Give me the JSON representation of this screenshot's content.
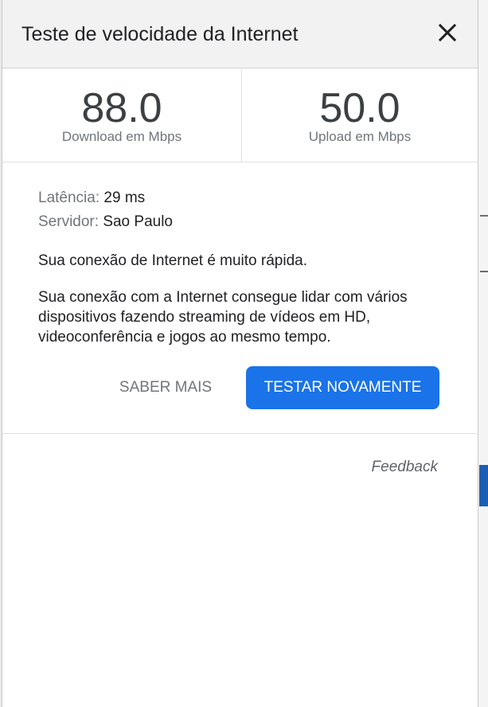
{
  "dialog": {
    "title": "Teste de velocidade da Internet",
    "close_icon": "close-icon"
  },
  "download": {
    "value": "88.0",
    "label": "Download em Mbps"
  },
  "upload": {
    "value": "50.0",
    "label": "Upload em Mbps"
  },
  "details": {
    "latency_label": "Latência:",
    "latency_value": "29 ms",
    "server_label": "Servidor:",
    "server_value": "Sao Paulo"
  },
  "summary": "Sua conexão de Internet é muito rápida.",
  "description": "Sua conexão com a Internet consegue lidar com vários dispositivos fazendo streaming de vídeos em HD, videoconferência e jogos ao mesmo tempo.",
  "actions": {
    "learn_more": "SABER MAIS",
    "retest": "TESTAR NOVAMENTE"
  },
  "feedback": "Feedback",
  "colors": {
    "accent": "#1a73e8",
    "header_bg": "#f2f2f2",
    "text_primary": "#202124",
    "text_secondary": "#70757a"
  }
}
